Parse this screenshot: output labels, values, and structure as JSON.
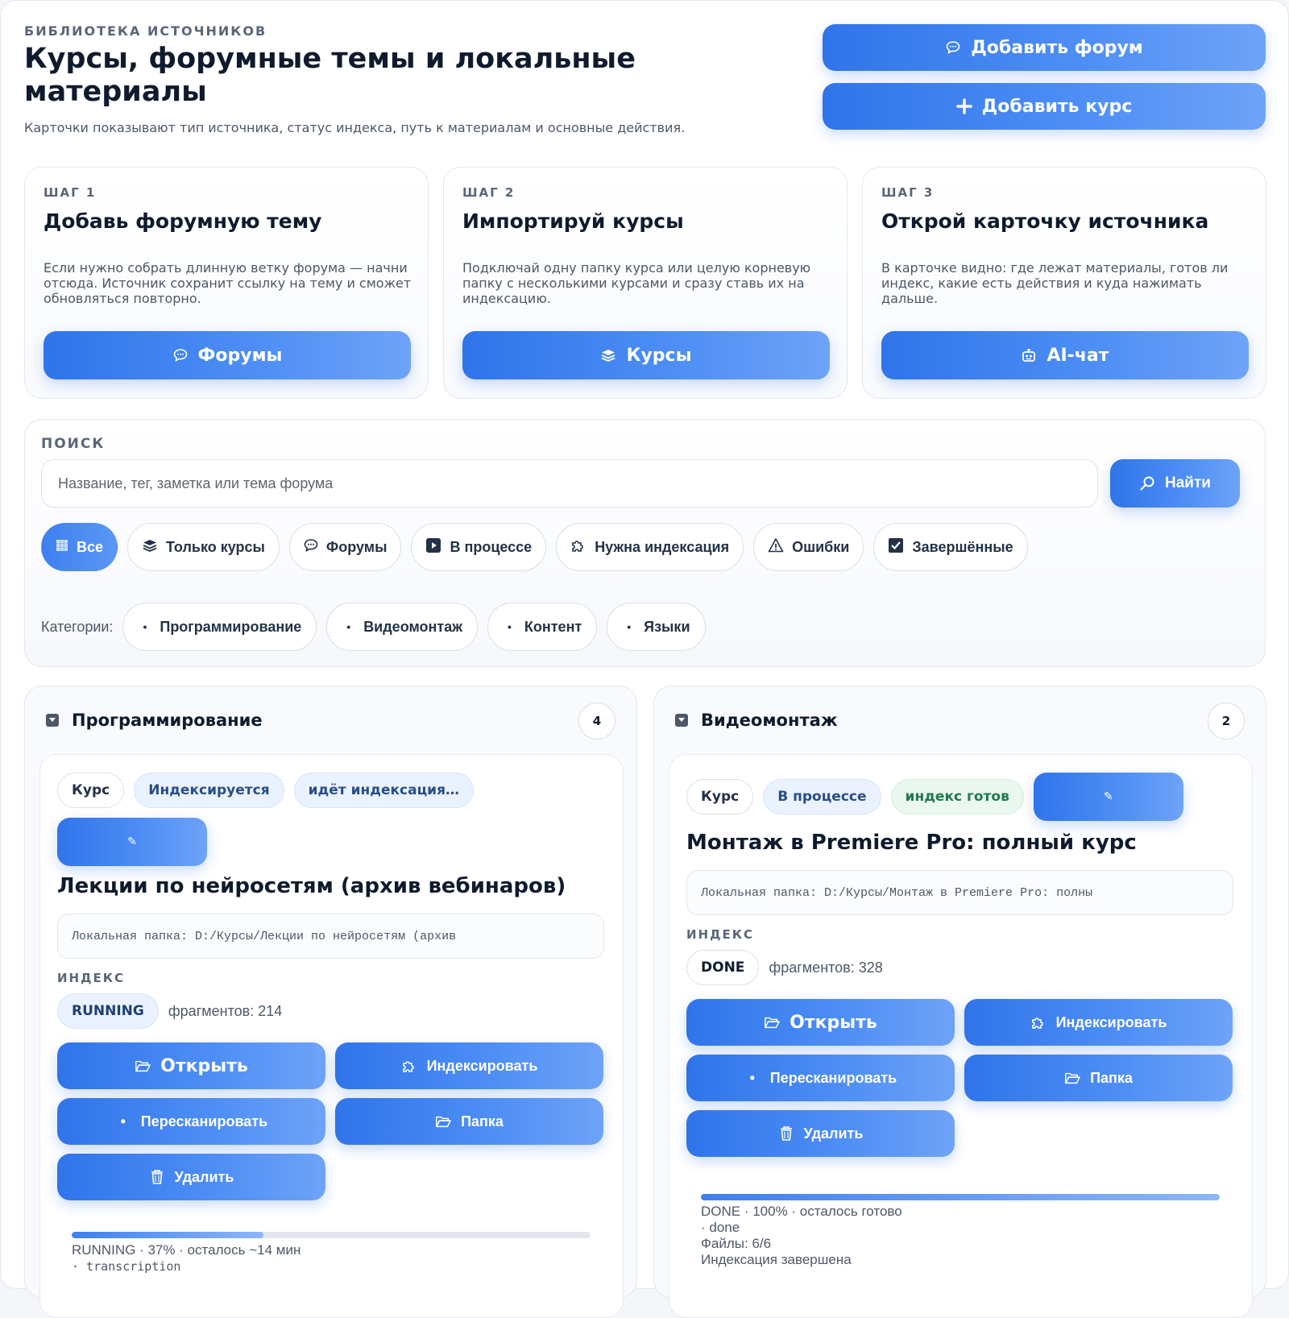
{
  "header": {
    "kicker": "БИБЛИОТЕКА ИСТОЧНИКОВ",
    "title": "Курсы, форумные темы и локальные материалы",
    "subtitle": "Карточки показывают тип источника, статус индекса, путь к материалам и основные действия.",
    "add_forum": "Добавить форум",
    "add_course": "Добавить курс"
  },
  "steps": [
    {
      "label": "ШАГ 1",
      "title": "Добавь форумную тему",
      "text": "Если нужно собрать длинную ветку форума — начни отсюда. Источник сохранит ссылку на тему и сможет обновляться повторно.",
      "button": "Форумы",
      "icon": "speech-bubble-icon"
    },
    {
      "label": "ШАГ 2",
      "title": "Импортируй курсы",
      "text": "Подключай одну папку курса или целую корневую папку с несколькими курсами и сразу ставь их на индексацию.",
      "button": "Курсы",
      "icon": "books-icon"
    },
    {
      "label": "ШАГ 3",
      "title": "Открой карточку источника",
      "text": "В карточке видно: где лежат материалы, готов ли индекс, какие есть действия и куда нажимать дальше.",
      "button": "AI-чат",
      "icon": "robot-icon"
    }
  ],
  "search": {
    "label": "ПОИСК",
    "placeholder": "Название, тег, заметка или тема форума",
    "button": "Найти"
  },
  "filters": [
    {
      "label": "Все",
      "icon": "grid-icon",
      "active": true
    },
    {
      "label": "Только курсы",
      "icon": "books-icon",
      "active": false
    },
    {
      "label": "Форумы",
      "icon": "speech-bubble-icon",
      "active": false
    },
    {
      "label": "В процессе",
      "icon": "play-icon",
      "active": false
    },
    {
      "label": "Нужна индексация",
      "icon": "puzzle-icon",
      "active": false
    },
    {
      "label": "Ошибки",
      "icon": "warning-icon",
      "active": false
    },
    {
      "label": "Завершённые",
      "icon": "checkbox-icon",
      "active": false
    }
  ],
  "categories_label": "Категории:",
  "categories": [
    "Программирование",
    "Видеомонтаж",
    "Контент",
    "Языки"
  ],
  "groups": [
    {
      "name": "Программирование",
      "count": "4",
      "card": {
        "tags": [
          "Курс",
          "Индексируется",
          "идёт индексация…"
        ],
        "edit_icon": "✎",
        "title": "Лекции по нейросетям (архив вебинаров)",
        "path": "Локальная папка: D:/Курсы/Лекции по нейросетям (архив",
        "index_label": "ИНДЕКС",
        "index_state": "RUNNING",
        "fragments": "фрагментов: 214",
        "actions": {
          "open": "Открыть",
          "index": "Индексировать",
          "rescan": "Пересканировать",
          "folder": "Папка",
          "delete": "Удалить"
        },
        "progress": 0.37,
        "progress_line1": "RUNNING · 37% · осталось ~14 мин",
        "progress_line2": "· transcription"
      }
    },
    {
      "name": "Видеомонтаж",
      "count": "2",
      "card": {
        "tags": [
          "Курс",
          "В процессе",
          "индекс готов"
        ],
        "edit_icon": "✎",
        "title": "Монтаж в Premiere Pro: полный курс",
        "path": "Локальная папка: D:/Курсы/Монтаж в Premiere Pro: полны",
        "index_label": "ИНДЕКС",
        "index_state": "DONE",
        "fragments": "фрагментов: 328",
        "actions": {
          "open": "Открыть",
          "index": "Индексировать",
          "rescan": "Пересканировать",
          "folder": "Папка",
          "delete": "Удалить"
        },
        "progress": 1.0,
        "progress_line1": "DONE · 100% · осталось готово",
        "progress_line2": "· done",
        "files": "Файлы: 6/6",
        "status": "Индексация завершена"
      }
    }
  ],
  "colors": {
    "accent": "#2f74ea",
    "accent_light": "#6ea3f7",
    "text": "#0f1b2d",
    "muted": "#4c5868"
  }
}
